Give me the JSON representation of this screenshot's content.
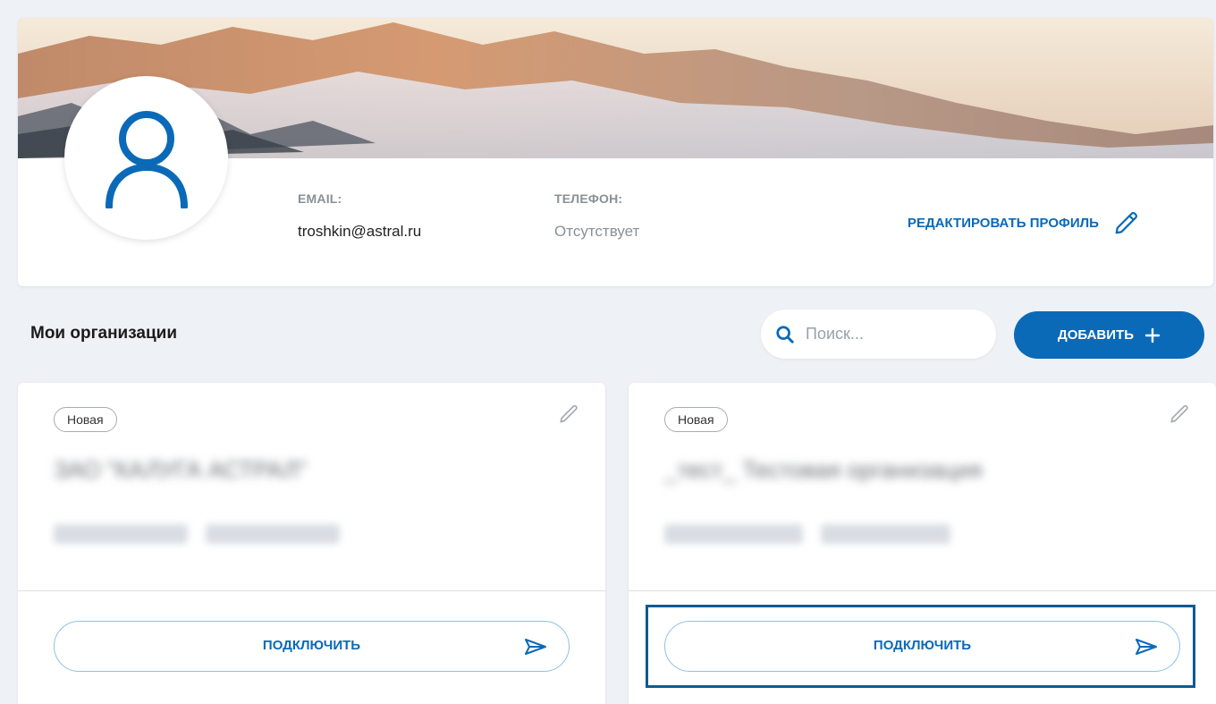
{
  "profile": {
    "email_label": "EMAIL:",
    "email_value": "troshkin@astral.ru",
    "phone_label": "ТЕЛЕФОН:",
    "phone_value": "Отсутствует",
    "edit_label": "РЕДАКТИРОВАТЬ ПРОФИЛЬ",
    "avatar_icon": "user-icon",
    "edit_icon": "pencil-icon"
  },
  "organizations": {
    "title": "Мои организации",
    "search_placeholder": "Поиск...",
    "search_icon": "search-icon",
    "add_label": "ДОБАВИТЬ",
    "add_icon": "plus-icon",
    "cards": [
      {
        "badge": "Новая",
        "name": "ЗАО \"КАЛУГА АСТРАЛ\"",
        "connect_label": "ПОДКЛЮЧИТЬ"
      },
      {
        "badge": "Новая",
        "name": "_тест_ Тестовая организация",
        "connect_label": "ПОДКЛЮЧИТЬ"
      }
    ]
  },
  "colors": {
    "accent": "#0a6ab8",
    "background": "#eef1f6",
    "focus_ring": "#0d5a93"
  }
}
